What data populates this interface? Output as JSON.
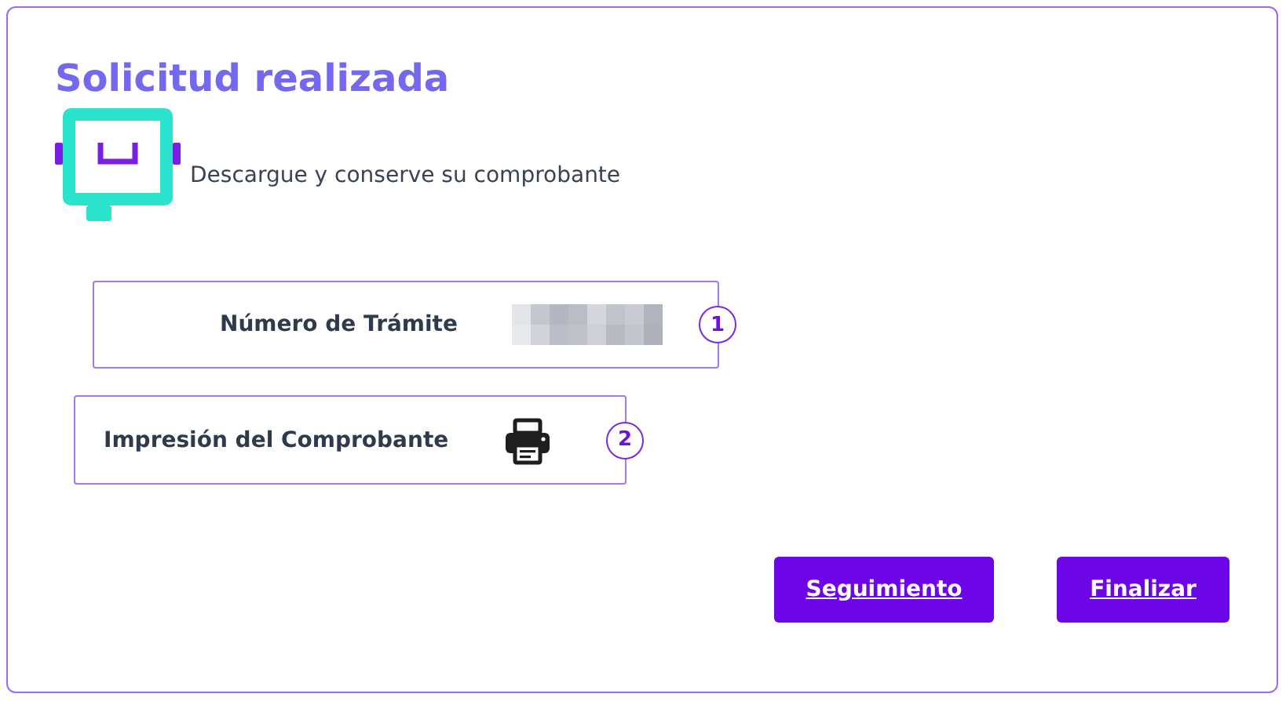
{
  "title": "Solicitud realizada",
  "subtitle": "Descargue y conserve su comprobante",
  "rows": [
    {
      "kind": "redacted",
      "label": "Número de Trámite",
      "badge": "1"
    },
    {
      "kind": "print",
      "label": "Impresión del Comprobante",
      "badge": "2"
    }
  ],
  "buttons": [
    "Seguimiento",
    "Finalizar"
  ]
}
